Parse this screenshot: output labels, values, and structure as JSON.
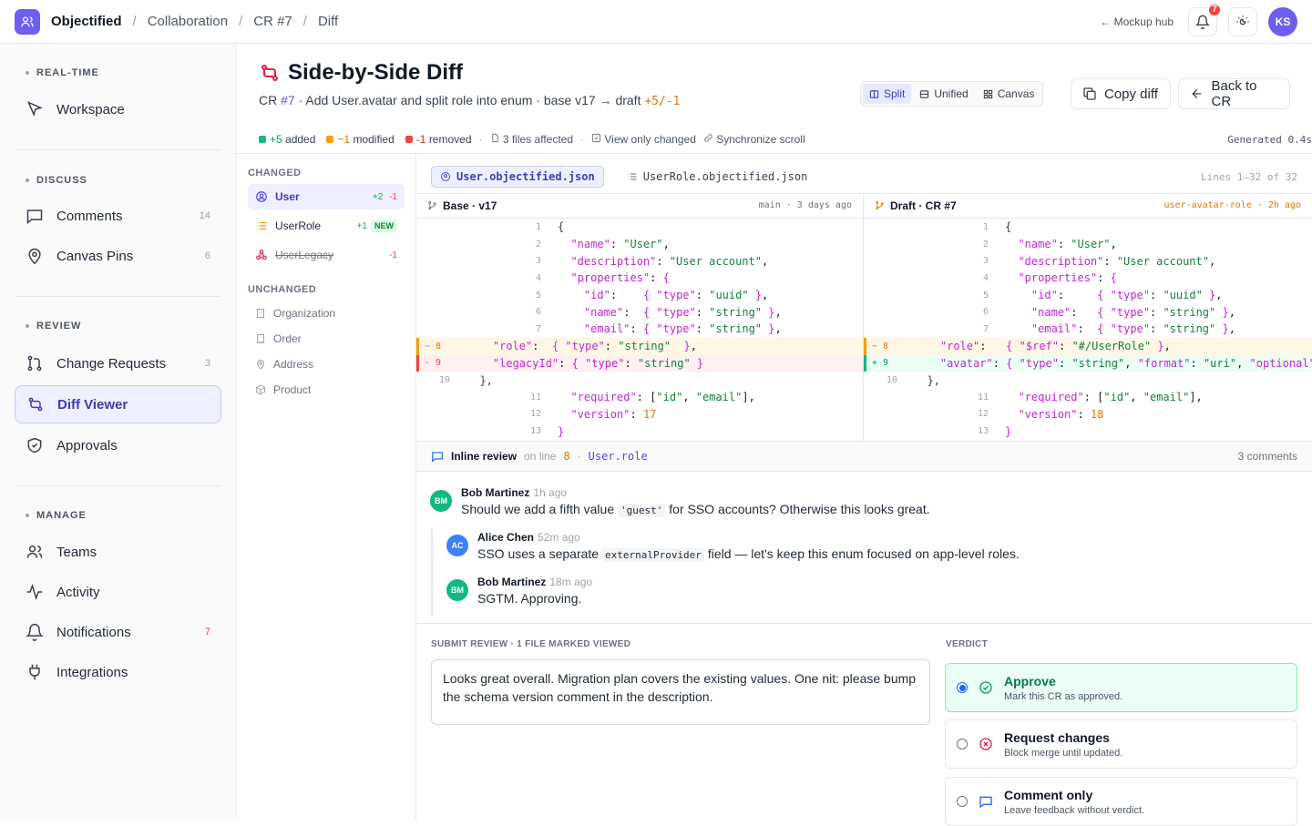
{
  "topbar": {
    "app_name": "Objectified",
    "breadcrumbs": [
      "Collaboration",
      "CR #7",
      "Diff"
    ],
    "mockup_hub": "← Mockup hub",
    "notifications_badge": "7",
    "user_initials": "KS"
  },
  "sidebar": {
    "sections": [
      {
        "title": "REAL-TIME",
        "items": [
          {
            "label": "Workspace",
            "icon": "cursor-icon"
          }
        ]
      },
      {
        "title": "DISCUSS",
        "items": [
          {
            "label": "Comments",
            "count": "14",
            "icon": "chat-icon"
          },
          {
            "label": "Canvas Pins",
            "count": "6",
            "icon": "pin-icon"
          }
        ]
      },
      {
        "title": "REVIEW",
        "items": [
          {
            "label": "Change Requests",
            "count": "3",
            "icon": "git-pull-icon"
          },
          {
            "label": "Diff Viewer",
            "icon": "git-compare-icon"
          },
          {
            "label": "Approvals",
            "icon": "shield-check-icon"
          }
        ]
      },
      {
        "title": "MANAGE",
        "items": [
          {
            "label": "Teams",
            "icon": "users-icon"
          },
          {
            "label": "Activity",
            "icon": "pulse-icon"
          },
          {
            "label": "Notifications",
            "count": "7",
            "icon": "bell-icon"
          },
          {
            "label": "Integrations",
            "icon": "plug-icon"
          }
        ]
      }
    ]
  },
  "header": {
    "title": "Side-by-Side Diff",
    "subtitle_prefix": "CR ",
    "cr_link": "#7",
    "subtitle_mid": " · Add User.avatar and split role into enum · base v17 → draft ",
    "subtitle_delta": "+5/-1",
    "view_modes": [
      "Split",
      "Unified",
      "Canvas"
    ],
    "copy_diff": "Copy diff",
    "back_to_cr": "Back to CR"
  },
  "stats": {
    "added": "+5",
    "added_label": "added",
    "modified": "~1",
    "modified_label": "modified",
    "removed": "-1",
    "removed_label": "removed",
    "files": "3 files affected",
    "view_only_changed": "View only changed",
    "sync_scroll": "Synchronize scroll",
    "generated": "Generated 0.4s"
  },
  "file_list": {
    "changed_title": "CHANGED",
    "changed": [
      {
        "name": "User",
        "plus": "+2",
        "minus": "-1"
      },
      {
        "name": "UserRole",
        "plus": "+1",
        "tag": "NEW"
      },
      {
        "name": "UserLegacy",
        "minus": "-1"
      }
    ],
    "unchanged_title": "UNCHANGED",
    "unchanged": [
      "Organization",
      "Order",
      "Address",
      "Product"
    ]
  },
  "diff_tabs": {
    "active": "User.objectified.json",
    "other": "UserRole.objectified.json",
    "lines": "Lines 1–32 of 32"
  },
  "base_pane": {
    "title": "Base · v17",
    "meta": "main · 3 days ago"
  },
  "draft_pane": {
    "title": "Draft · CR #7",
    "meta": "user-avatar-role · 2h ago"
  },
  "inline_review": {
    "title": "Inline review",
    "on_line": "on line",
    "line": "8",
    "field": "User.role",
    "count": "3 comments",
    "comments": [
      {
        "initials": "BM",
        "author": "Bob Martinez",
        "time": "1h ago",
        "pre": "Should we add a fifth value ",
        "code": "'guest'",
        "post": " for SSO accounts? Otherwise this looks great."
      },
      {
        "initials": "AC",
        "author": "Alice Chen",
        "time": "52m ago",
        "pre": "SSO uses a separate ",
        "code": "externalProvider",
        "post": " field — let's keep this enum focused on app-level roles."
      },
      {
        "initials": "BM",
        "author": "Bob Martinez",
        "time": "18m ago",
        "pre": "SGTM. Approving.",
        "code": "",
        "post": ""
      }
    ]
  },
  "submit": {
    "title": "SUBMIT REVIEW · 1 FILE MARKED VIEWED",
    "text": "Looks great overall. Migration plan covers the existing values. One nit: please bump the schema version comment in the description."
  },
  "verdict": {
    "title": "VERDICT",
    "options": [
      {
        "label": "Approve",
        "desc": "Mark this CR as approved."
      },
      {
        "label": "Request changes",
        "desc": "Block merge until updated."
      },
      {
        "label": "Comment only",
        "desc": "Leave feedback without verdict."
      }
    ]
  },
  "colors": {
    "accent": "#6d5ef0",
    "added": "#10b981",
    "modified": "#f59e0b",
    "removed": "#ef4444"
  }
}
